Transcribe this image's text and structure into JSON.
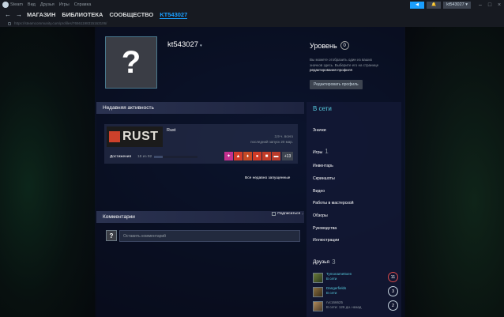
{
  "titlebar": {
    "app": "Steam",
    "menu": [
      "Вид",
      "Друзья",
      "Игры",
      "Справка"
    ],
    "user": "kt543027"
  },
  "nav": {
    "items": [
      "МАГАЗИН",
      "БИБЛИОТЕКА",
      "СООБЩЕСТВО",
      "KT543027"
    ]
  },
  "url": "https://steamcommunity.com/profiles/76561198315163106/",
  "profile": {
    "avatar_glyph": "?",
    "name": "kt543027",
    "caret": "▾"
  },
  "level": {
    "title": "Уровень",
    "value": "0",
    "note_line1": "Вы можете отобразить один из ваших",
    "note_line2": "значков здесь. Выберите его на странице",
    "note_link": "редактирования профиля",
    "edit_button": "Редактировать профиль"
  },
  "activity": {
    "title": "Недавняя активность",
    "game": {
      "capsule": "RUST",
      "name": "Rust",
      "hours": "3,9 ч. всего",
      "last_played": "последний запуск 20 мар."
    },
    "achievements_label": "Достижения",
    "achievements_count": "18 из 92",
    "achievements_progress": 0.196,
    "more": "+13",
    "all_recent": "Все недавно запущенные"
  },
  "comments": {
    "title": "Комментарии",
    "subscribe": "Подписаться",
    "subscribe_sup": "?",
    "avatar_glyph": "?",
    "placeholder": "Оставить комментарий"
  },
  "side": {
    "status": "В сети",
    "links": {
      "badges": "Значки",
      "games": "Игры",
      "games_count": "1",
      "inventory": "Инвентарь",
      "screenshots": "Скриншоты",
      "videos": "Видео",
      "workshop": "Работы в мастерской",
      "reviews": "Обзоры",
      "guides": "Руководства",
      "artwork": "Иллюстрации"
    },
    "friends_title": "Друзья",
    "friends_count": "3",
    "friends": [
      {
        "name": "Tymonamettoen",
        "status": "В сети",
        "level": "11"
      },
      {
        "name": "Dangerfields",
        "status": "В сети",
        "level": "3"
      },
      {
        "name": "rvc166625",
        "status": "В сети: 126 дн. назад",
        "level": "2"
      }
    ]
  },
  "colors": {
    "accent": "#1a9fff",
    "online": "#57cbde",
    "rust_red": "#cd412b"
  }
}
